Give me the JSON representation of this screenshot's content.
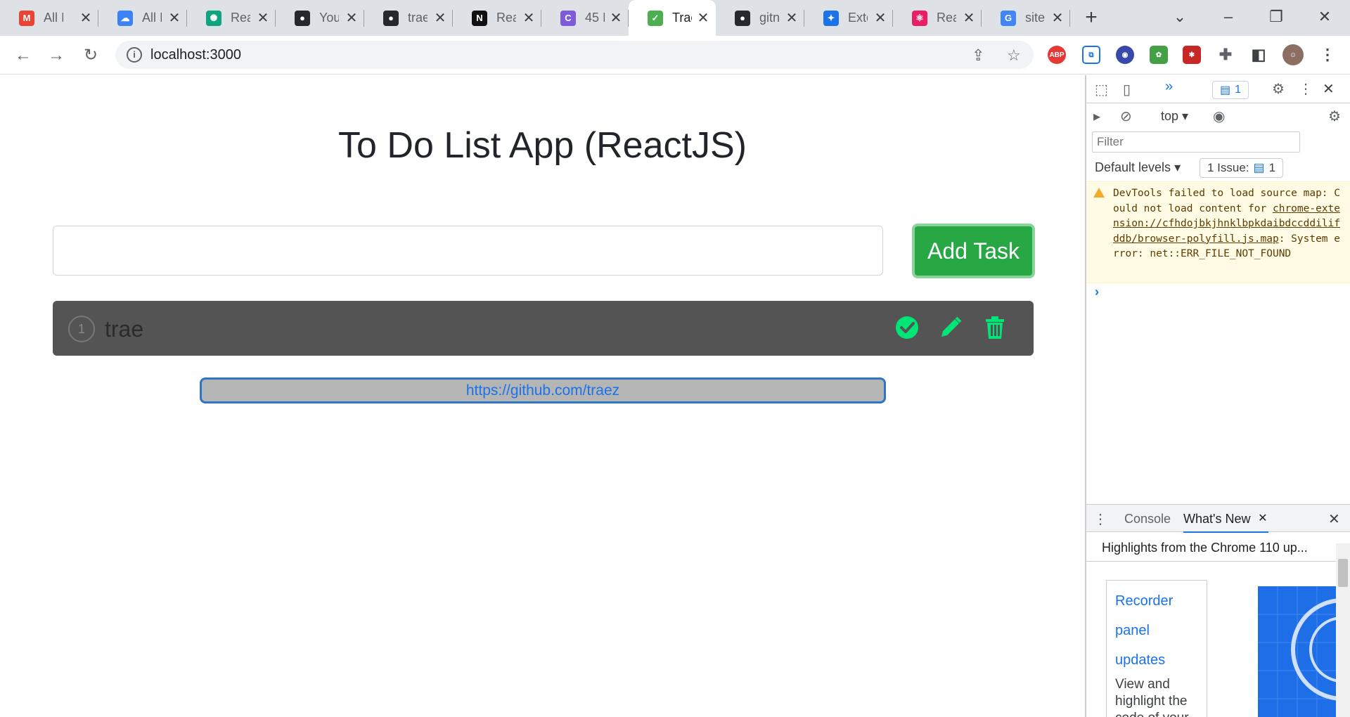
{
  "browser": {
    "tabs": [
      {
        "label": "All I",
        "icon": "gmail-icon",
        "favicon_text": "M",
        "color": "#ea4335"
      },
      {
        "label": "All I",
        "icon": "cloud-icon",
        "favicon_text": "☁",
        "color": "#3b82f6"
      },
      {
        "label": "Rea",
        "icon": "chatgpt-icon",
        "favicon_text": "✺",
        "color": "#10a37f"
      },
      {
        "label": "You",
        "icon": "github-icon",
        "favicon_text": "●",
        "color": "#24292f"
      },
      {
        "label": "trae",
        "icon": "github-icon",
        "favicon_text": "●",
        "color": "#24292f"
      },
      {
        "label": "Rea",
        "icon": "notion-icon",
        "favicon_text": "N",
        "color": "#111111"
      },
      {
        "label": "45 I",
        "icon": "canva-icon",
        "favicon_text": "C",
        "color": "#7d5bd9"
      },
      {
        "label": "Trac",
        "icon": "app-favicon-icon",
        "favicon_text": "✓",
        "color": "#4caf50",
        "active": true
      },
      {
        "label": "gitn",
        "icon": "github-icon",
        "favicon_text": "●",
        "color": "#24292f"
      },
      {
        "label": "Exte",
        "icon": "puzzle-icon",
        "favicon_text": "✦",
        "color": "#1a73e8"
      },
      {
        "label": "Rea",
        "icon": "react-icon",
        "favicon_text": "⚛",
        "color": "#e91e63"
      },
      {
        "label": "site",
        "icon": "google-icon",
        "favicon_text": "G",
        "color": "#4285f4"
      }
    ],
    "url": "localhost:3000"
  },
  "app": {
    "title": "To Do List App (ReactJS)",
    "input_value": "",
    "add_button_label": "Add Task",
    "tasks": [
      {
        "number": "1",
        "text": "trae"
      }
    ],
    "github_link": "https://github.com/traez",
    "colors": {
      "accent": "#28a745",
      "task_bg": "#545454",
      "task_icons": "#00e676"
    }
  },
  "devtools": {
    "issues_badge": "1",
    "context": "top",
    "filter_placeholder": "Filter",
    "levels": "Default levels",
    "issue_count": "1 Issue:",
    "issue_count_value": "1",
    "message": {
      "prefix": "DevTools failed to load source map: Could not load content for ",
      "link": "chrome-extension://cfhdojbkjhnklbpkdaibdccddilifddb/browser-polyfill.js.map",
      "suffix": ": System error: net::ERR_FILE_NOT_FOUND"
    },
    "drawer_tabs": [
      "Console",
      "What's New"
    ],
    "whats_new_header": "Highlights from the Chrome 110 up...",
    "feature": {
      "links": [
        "Recorder",
        "panel",
        "updates"
      ],
      "description": "View and highlight the code of your"
    }
  }
}
